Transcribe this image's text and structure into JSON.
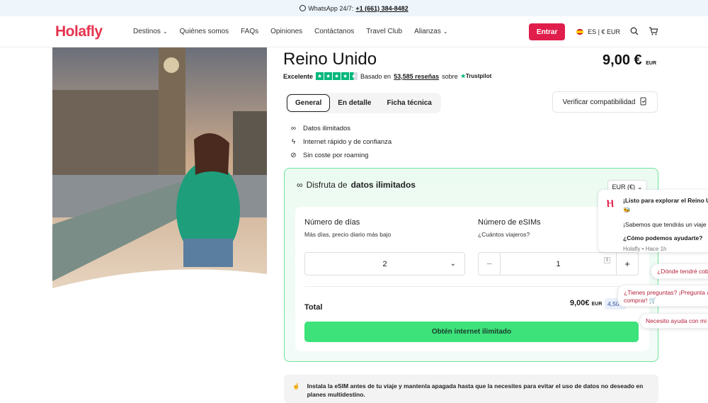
{
  "topbar": {
    "prefix": "WhatsApp 24/7:",
    "phone": "+1 (661) 384-8482"
  },
  "nav": {
    "logo": "Holafly",
    "items": [
      {
        "label": "Destinos",
        "dropdown": true
      },
      {
        "label": "Quiénes somos",
        "dropdown": false
      },
      {
        "label": "FAQs",
        "dropdown": false
      },
      {
        "label": "Opiniones",
        "dropdown": false
      },
      {
        "label": "Contáctanos",
        "dropdown": false
      },
      {
        "label": "Travel Club",
        "dropdown": false
      },
      {
        "label": "Alianzas",
        "dropdown": true
      }
    ],
    "login_label": "Entrar",
    "lang_label": "ES | € EUR"
  },
  "product": {
    "title": "Reino Unido",
    "price": "9,00 €",
    "price_currency": "EUR",
    "rating_label": "Excelente",
    "rating_stars": 4.5,
    "based_on": "Basado en",
    "reviews": "53,585 reseñas",
    "on": "sobre",
    "trustpilot": "Trustpilot"
  },
  "tabs": [
    {
      "label": "General",
      "active": true
    },
    {
      "label": "En detalle",
      "active": false
    },
    {
      "label": "Ficha técnica",
      "active": false
    }
  ],
  "compat_label": "Verificar compatibilidad",
  "features": [
    {
      "icon": "infinity-icon",
      "label": "Datos ilimitados"
    },
    {
      "icon": "bolt-icon",
      "label": "Internet rápido y de confianza"
    },
    {
      "icon": "no-roaming-icon",
      "label": "Sin coste por roaming"
    }
  ],
  "plan": {
    "heading_pre": "Disfruta de",
    "heading_bold": "datos ilimitados",
    "currency_select": "EUR (€)",
    "days_label": "Número de días",
    "days_sub": "Más días, precio diario más bajo",
    "days_value": "2",
    "esims_label": "Número de eSIMs",
    "esims_sub": "¿Cuántos viajeros?",
    "esims_value": "1",
    "total_label": "Total",
    "total_value": "9,00€",
    "total_currency": "EUR",
    "daily_badge": "4,50",
    "cta": "Obtén internet ilimitado"
  },
  "note": "Instala la eSIM antes de tu viaje y mantenla apagada hasta que la necesites para evitar el uso de datos no deseado en planes multidestino.",
  "chat": {
    "line1": "¡Listo para explorar el Reino Unido?",
    "line2": "🐝",
    "line3": "¡Sabemos que tendrás un viaje increíble!",
    "line4": "¿Cómo podemos ayudarte?",
    "line5": "Holafly • Hace 1h"
  },
  "bubbles": [
    "¿Dónde tendré cobertura?",
    "¿Tienes preguntas? ¡Pregunta antes de",
    "comprar! 🛒",
    "Necesito ayuda con mi eSIM"
  ]
}
